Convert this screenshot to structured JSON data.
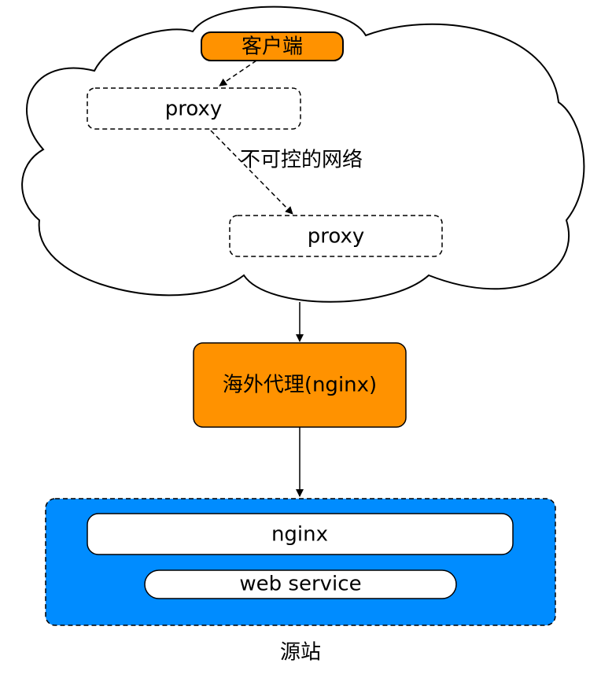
{
  "cloud": {
    "client_label": "客户端",
    "proxy_top_label": "proxy",
    "network_label": "不可控的网络",
    "proxy_bottom_label": "proxy"
  },
  "overseas_proxy": {
    "label": "海外代理(nginx)"
  },
  "origin": {
    "nginx_label": "nginx",
    "web_service_label": "web service",
    "caption": "源站"
  },
  "colors": {
    "orange": "#ff9200",
    "blue": "#008cff",
    "stroke": "#000000",
    "white": "#ffffff"
  }
}
